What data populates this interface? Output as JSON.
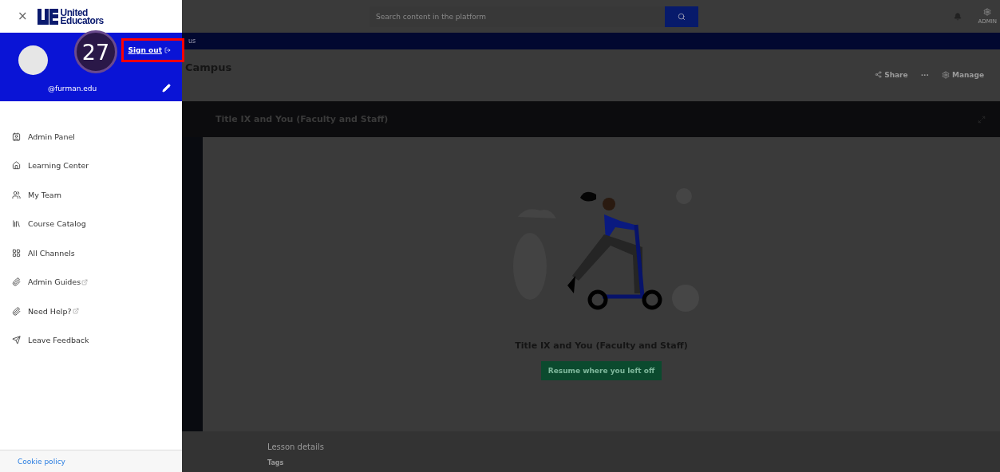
{
  "drawer": {
    "close": "×",
    "logo": {
      "line1": "United",
      "line2": "Educators"
    },
    "profile": {
      "email": "@furman.edu",
      "sign_out": "Sign out"
    },
    "menu": [
      {
        "label": "Admin Panel",
        "kind": "panel",
        "external": false
      },
      {
        "label": "Learning Center",
        "kind": "home",
        "external": false
      },
      {
        "label": "My Team",
        "kind": "team",
        "external": false
      },
      {
        "label": "Course Catalog",
        "kind": "catalog",
        "external": false
      },
      {
        "label": "All Channels",
        "kind": "channels",
        "external": false
      },
      {
        "label": "Admin Guides",
        "kind": "attachment",
        "external": true
      },
      {
        "label": "Need Help?",
        "kind": "attachment",
        "external": true
      },
      {
        "label": "Leave Feedback",
        "kind": "send",
        "external": false
      }
    ],
    "footer": {
      "link": "Cookie policy"
    }
  },
  "annotation": {
    "step": "27",
    "highlight": true
  },
  "topbar": {
    "search": {
      "placeholder": "Search content in the platform"
    },
    "admin": "ADMIN"
  },
  "breadcrumb": "us",
  "page": {
    "title": "Campus",
    "actions": [
      "Share",
      "···",
      "Manage"
    ]
  },
  "lesson_bar": {
    "title": "Title IX and You (Faculty and Staff)"
  },
  "content": {
    "title": "Title IX and You (Faculty and Staff)",
    "button": "Resume where you left off"
  },
  "details": {
    "heading": "Lesson details",
    "tags": "Tags"
  }
}
